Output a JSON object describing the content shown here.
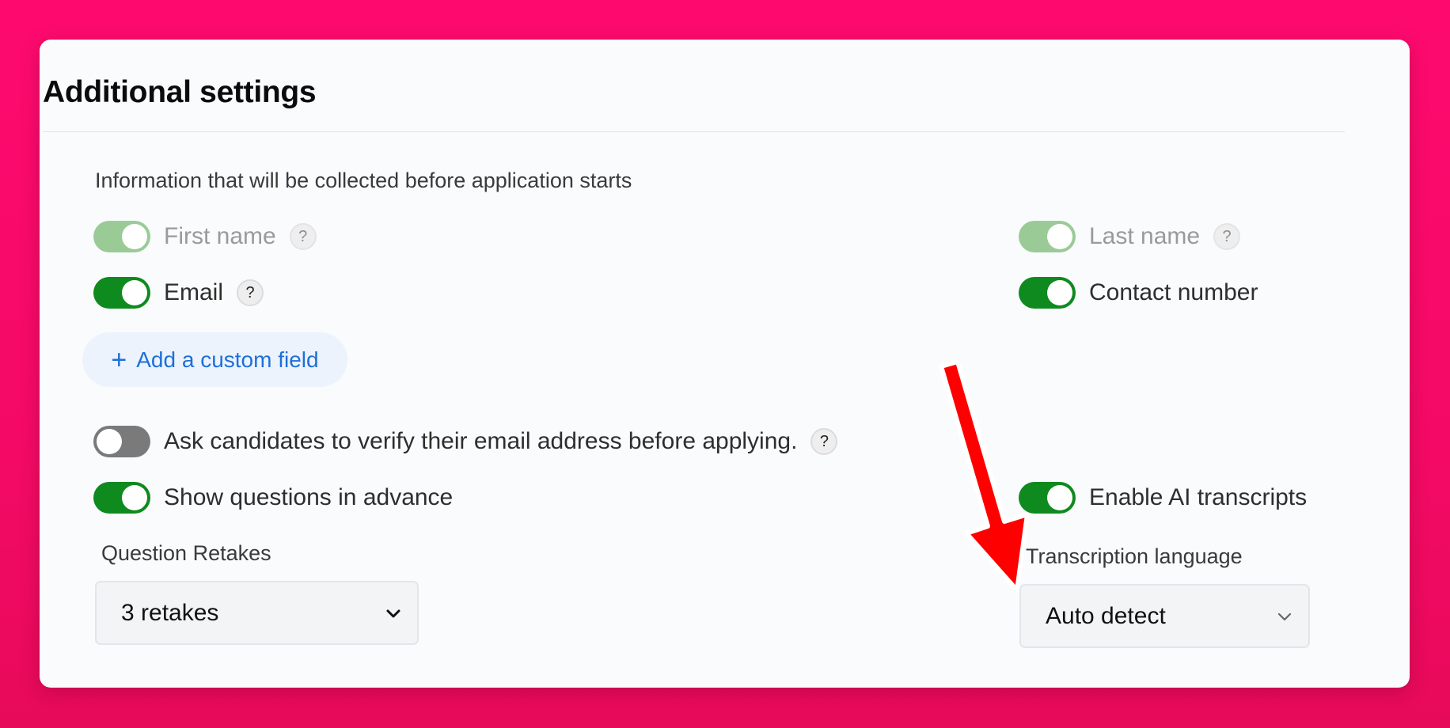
{
  "panel": {
    "title": "Additional settings",
    "info_text": "Information that will be collected before application starts"
  },
  "fields": {
    "first_name": {
      "label": "First name",
      "enabled": true,
      "locked": true
    },
    "last_name": {
      "label": "Last name",
      "enabled": true,
      "locked": true
    },
    "email": {
      "label": "Email",
      "enabled": true
    },
    "contact_number": {
      "label": "Contact number",
      "enabled": true
    }
  },
  "add_custom_field": {
    "icon": "plus-icon",
    "label": "Add a custom field"
  },
  "options": {
    "verify_email": {
      "label": "Ask candidates to verify their email address before applying.",
      "enabled": false
    },
    "show_questions": {
      "label": "Show questions in advance",
      "enabled": true
    },
    "ai_transcripts": {
      "label": "Enable AI transcripts",
      "enabled": true
    }
  },
  "help_icon": "?",
  "retakes": {
    "label": "Question Retakes",
    "value": "3 retakes"
  },
  "transcription": {
    "label": "Transcription language",
    "value": "Auto detect"
  },
  "colors": {
    "toggle_on": "#0e8a1f",
    "toggle_on_locked": "#9acb97",
    "toggle_off": "#7a7a7a",
    "link": "#1e6fd9",
    "annotation_arrow": "#ff0000",
    "background": "#fe0a6f"
  }
}
